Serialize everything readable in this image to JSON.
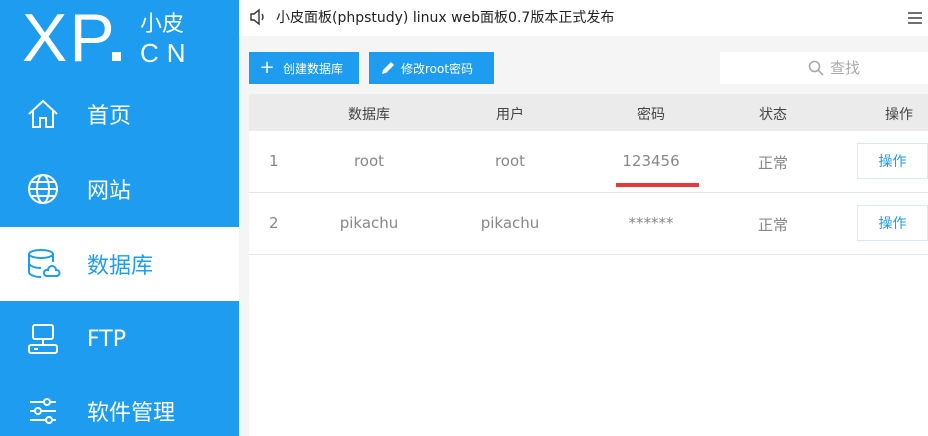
{
  "logo": {
    "xp": "XP",
    "cn_top": "小皮",
    "cn_bottom": "CN"
  },
  "sidebar": {
    "items": [
      {
        "label": "首页",
        "icon": "home-icon",
        "active": false
      },
      {
        "label": "网站",
        "icon": "globe-icon",
        "active": false
      },
      {
        "label": "数据库",
        "icon": "database-icon",
        "active": true
      },
      {
        "label": "FTP",
        "icon": "server-icon",
        "active": false
      },
      {
        "label": "软件管理",
        "icon": "sliders-icon",
        "active": false
      }
    ]
  },
  "topbar": {
    "notice": "小皮面板(phpstudy) linux web面板0.7版本正式发布"
  },
  "toolbar": {
    "create_label": "创建数据库",
    "root_password_label": "修改root密码"
  },
  "search": {
    "placeholder": "查找"
  },
  "table": {
    "headers": [
      "数据库",
      "用户",
      "密码",
      "状态",
      "操作"
    ],
    "rows": [
      {
        "index": "1",
        "database": "root",
        "user": "root",
        "password": "123456",
        "status": "正常",
        "action": "操作"
      },
      {
        "index": "2",
        "database": "pikachu",
        "user": "pikachu",
        "password": "******",
        "status": "正常",
        "action": "操作"
      }
    ]
  },
  "colors": {
    "accent": "#1e9cef",
    "highlight": "#e8393a"
  }
}
